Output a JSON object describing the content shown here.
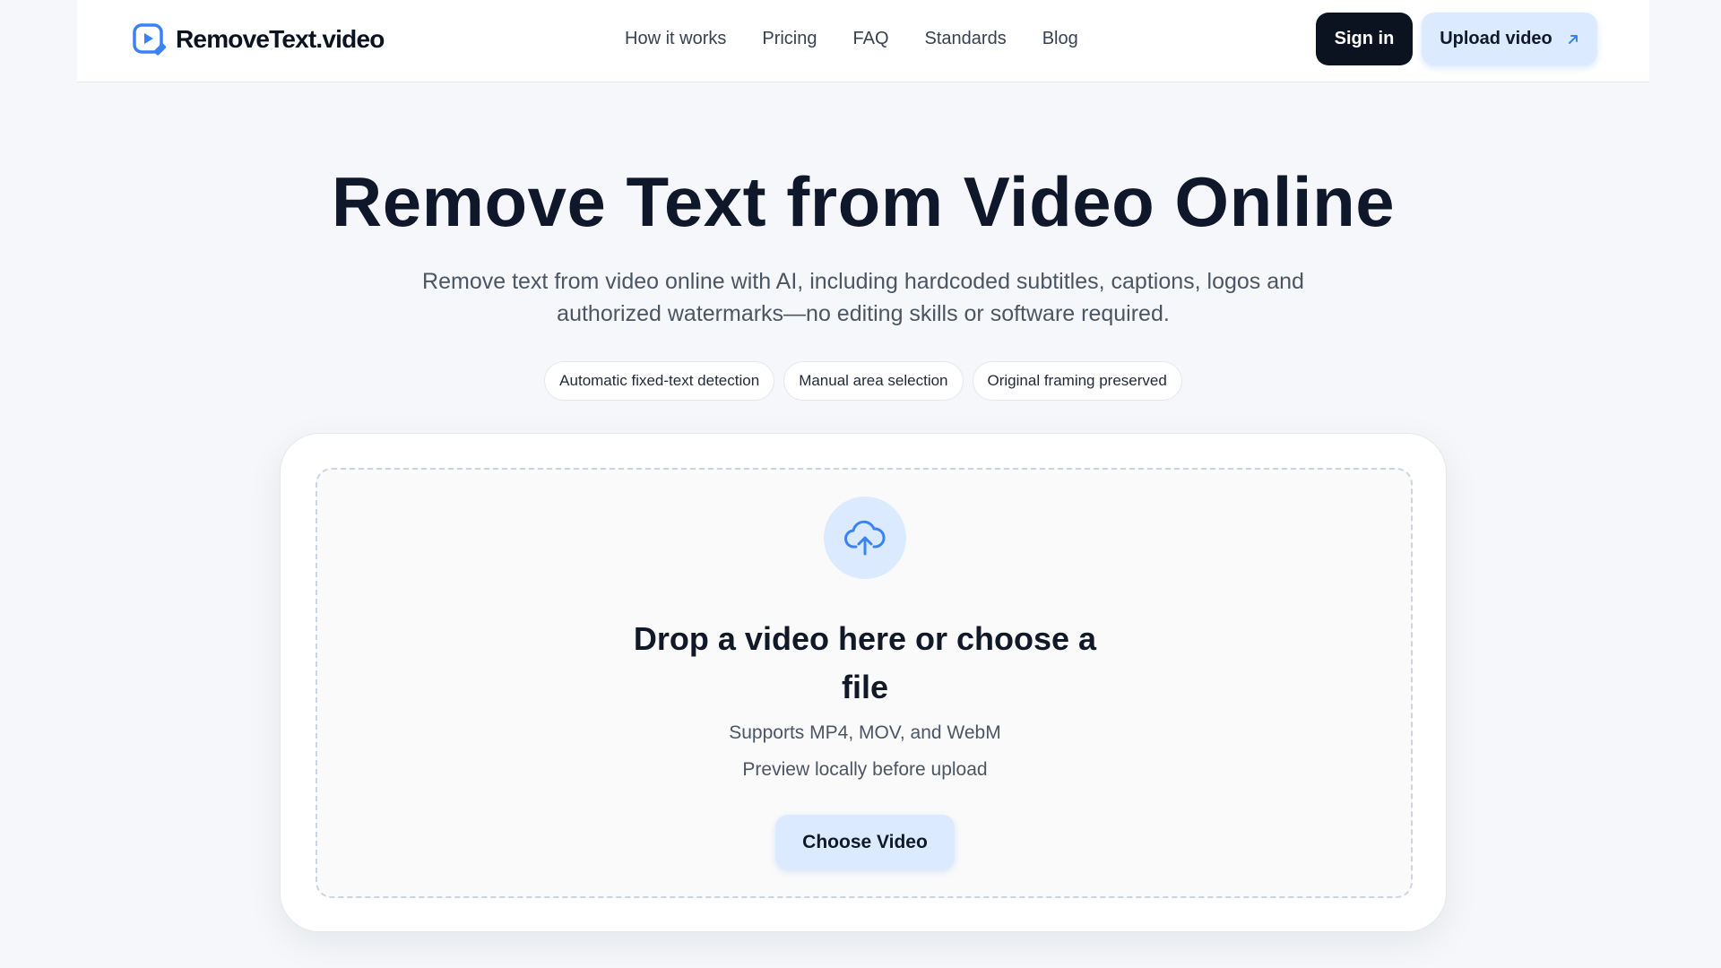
{
  "header": {
    "logo_text": "RemoveText.video",
    "nav": [
      {
        "label": "How it works"
      },
      {
        "label": "Pricing"
      },
      {
        "label": "FAQ"
      },
      {
        "label": "Standards"
      },
      {
        "label": "Blog"
      }
    ],
    "signin_label": "Sign in",
    "upload_label": "Upload video",
    "upload_icon": "arrow-up-right-icon"
  },
  "hero": {
    "title": "Remove Text from Video Online",
    "subtitle": "Remove text from video online with AI, including hardcoded subtitles, captions, logos and authorized watermarks—no editing skills or software required.",
    "chips": [
      "Automatic fixed-text detection",
      "Manual area selection",
      "Original framing preserved"
    ]
  },
  "upload_card": {
    "icon": "cloud-upload-icon",
    "title": "Drop a video here or choose a file",
    "formats": "Supports MP4, MOV, and WebM",
    "preview_note": "Preview locally before upload",
    "button_label": "Choose Video"
  },
  "colors": {
    "accent": "#3b82f6",
    "accent_light": "#dbeafe",
    "dark_button": "#0b1220",
    "page_background": "#f5f7fa"
  }
}
